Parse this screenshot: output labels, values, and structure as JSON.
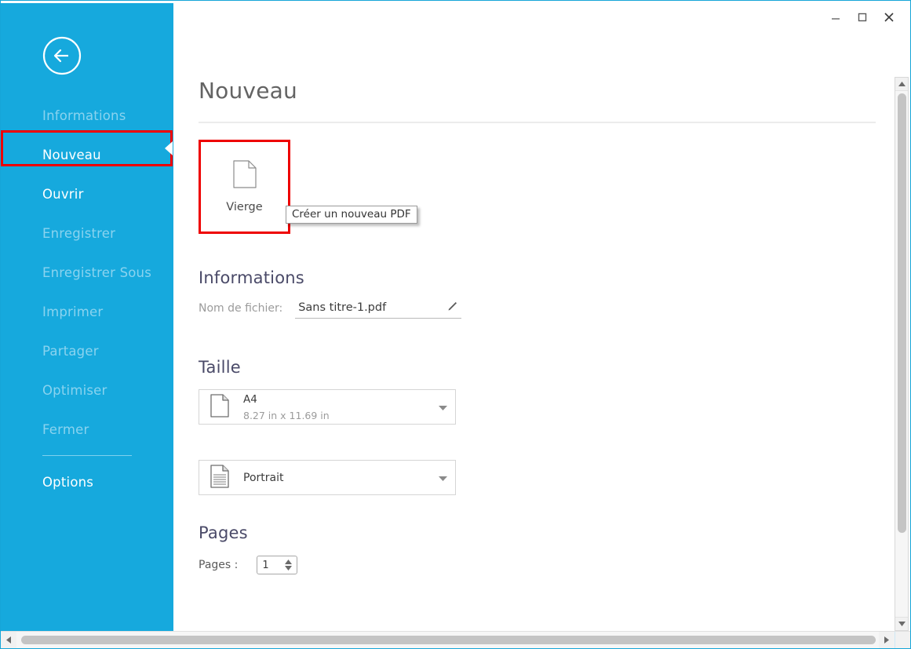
{
  "window": {
    "controls": {
      "minimize_label": "Minimiser",
      "maximize_label": "Agrandir",
      "close_label": "Fermer"
    }
  },
  "sidebar": {
    "back_label": "Retour",
    "items": [
      {
        "label": "Informations",
        "state": "disabled"
      },
      {
        "label": "Nouveau",
        "state": "selected"
      },
      {
        "label": "Ouvrir",
        "state": "enabled"
      },
      {
        "label": "Enregistrer",
        "state": "disabled"
      },
      {
        "label": "Enregistrer Sous",
        "state": "disabled"
      },
      {
        "label": "Imprimer",
        "state": "disabled"
      },
      {
        "label": "Partager",
        "state": "disabled"
      },
      {
        "label": "Optimiser",
        "state": "disabled"
      },
      {
        "label": "Fermer",
        "state": "disabled"
      }
    ],
    "options_label": "Options",
    "colors": {
      "background": "#16a9dd",
      "enabled_text": "#ffffff",
      "disabled_text": "#8ad3ef",
      "divider": "#7fd0ee"
    }
  },
  "main": {
    "page_title": "Nouveau",
    "template": {
      "card_label": "Vierge",
      "tooltip": "Créer un nouveau PDF",
      "icon": "blank-page-icon"
    },
    "informations": {
      "heading": "Informations",
      "filename_label": "Nom de fichier:",
      "filename_value": "Sans titre-1.pdf",
      "edit_icon": "pencil-icon"
    },
    "taille": {
      "heading": "Taille",
      "size": {
        "name": "A4",
        "dimensions": "8.27 in x 11.69 in",
        "icon": "page-icon"
      },
      "orientation": {
        "name": "Portrait",
        "icon": "portrait-page-icon"
      }
    },
    "pages": {
      "heading": "Pages",
      "label": "Pages :",
      "value": "1"
    }
  },
  "annotation": {
    "highlight_color": "#ee0000"
  }
}
